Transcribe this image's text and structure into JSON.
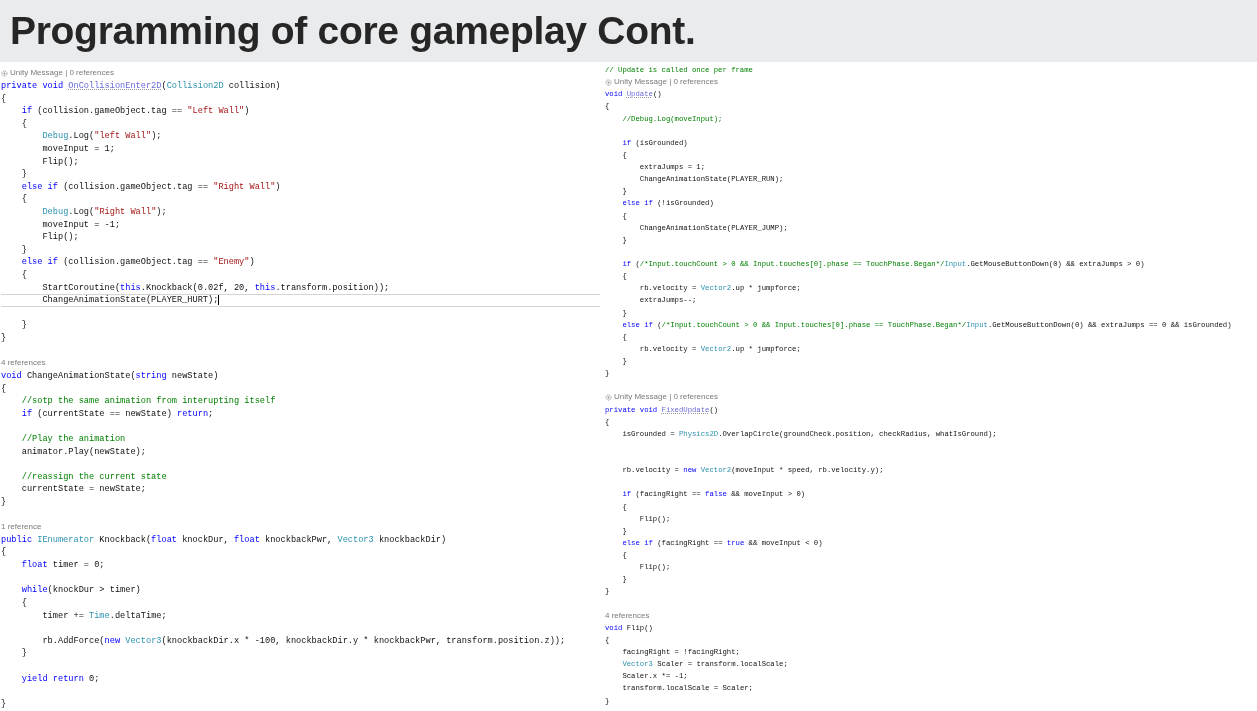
{
  "slide": {
    "title": "Programming of core gameplay Cont."
  },
  "panels": [
    {
      "lines": [
        {
          "kind": "hint_unity",
          "text": "Unity Message | 0 references"
        },
        {
          "kind": "code",
          "parts": [
            {
              "kind": "keyword",
              "text": "private void "
            },
            {
              "kind": "message",
              "text": "OnCollisionEnter2D"
            },
            {
              "text": "("
            },
            {
              "kind": "type",
              "text": "Collision2D"
            },
            {
              "text": " collision)"
            }
          ]
        },
        {
          "kind": "code",
          "parts": [
            {
              "text": "{"
            }
          ]
        },
        {
          "kind": "code",
          "parts": [
            {
              "kind": "keyword",
              "text": "    if"
            },
            {
              "text": " (collision.gameObject.tag == "
            },
            {
              "kind": "string",
              "text": "\"Left Wall\""
            },
            {
              "text": ")"
            }
          ]
        },
        {
          "kind": "code",
          "parts": [
            {
              "text": "    {"
            }
          ]
        },
        {
          "kind": "code",
          "parts": [
            {
              "kind": "type",
              "text": "        Debug"
            },
            {
              "text": ".Log("
            },
            {
              "kind": "string",
              "text": "\"left Wall\""
            },
            {
              "text": ");"
            }
          ]
        },
        {
          "kind": "code",
          "parts": [
            {
              "text": "        moveInput = 1;"
            }
          ]
        },
        {
          "kind": "code",
          "parts": [
            {
              "text": "        Flip();"
            }
          ]
        },
        {
          "kind": "code",
          "parts": [
            {
              "text": "    }"
            }
          ]
        },
        {
          "kind": "code",
          "parts": [
            {
              "kind": "keyword",
              "text": "    else if"
            },
            {
              "text": " (collision.gameObject.tag == "
            },
            {
              "kind": "string",
              "text": "\"Right Wall\""
            },
            {
              "text": ")"
            }
          ]
        },
        {
          "kind": "code",
          "parts": [
            {
              "text": "    {"
            }
          ]
        },
        {
          "kind": "code",
          "parts": [
            {
              "kind": "type",
              "text": "        Debug"
            },
            {
              "text": ".Log("
            },
            {
              "kind": "string",
              "text": "\"Right Wall\""
            },
            {
              "text": ");"
            }
          ]
        },
        {
          "kind": "code",
          "parts": [
            {
              "text": "        moveInput = -1;"
            }
          ]
        },
        {
          "kind": "code",
          "parts": [
            {
              "text": "        Flip();"
            }
          ]
        },
        {
          "kind": "code",
          "parts": [
            {
              "text": "    }"
            }
          ]
        },
        {
          "kind": "code",
          "parts": [
            {
              "kind": "keyword",
              "text": "    else if"
            },
            {
              "text": " (collision.gameObject.tag == "
            },
            {
              "kind": "string",
              "text": "\"Enemy\""
            },
            {
              "text": ")"
            }
          ]
        },
        {
          "kind": "code",
          "parts": [
            {
              "text": "    {"
            }
          ]
        },
        {
          "kind": "code",
          "parts": [
            {
              "text": "        StartCoroutine("
            },
            {
              "kind": "keyword",
              "text": "this"
            },
            {
              "text": ".Knockback(0.02f, 20, "
            },
            {
              "kind": "keyword",
              "text": "this"
            },
            {
              "text": ".transform.position));"
            }
          ]
        },
        {
          "kind": "current",
          "parts": [
            {
              "text": "        ChangeAnimationState(PLAYER_HURT);"
            }
          ]
        },
        {
          "kind": "blank"
        },
        {
          "kind": "code",
          "parts": [
            {
              "text": "    }"
            }
          ]
        },
        {
          "kind": "code",
          "parts": [
            {
              "text": "}"
            }
          ]
        },
        {
          "kind": "blank"
        },
        {
          "kind": "hint",
          "text": "4 references"
        },
        {
          "kind": "code",
          "parts": [
            {
              "kind": "keyword",
              "text": "void"
            },
            {
              "text": " ChangeAnimationState("
            },
            {
              "kind": "keyword",
              "text": "string"
            },
            {
              "text": " newState)"
            }
          ]
        },
        {
          "kind": "code",
          "parts": [
            {
              "text": "{"
            }
          ]
        },
        {
          "kind": "code",
          "parts": [
            {
              "kind": "comment",
              "text": "    //sotp the same animation from interupting itself"
            }
          ]
        },
        {
          "kind": "code",
          "parts": [
            {
              "kind": "keyword",
              "text": "    if"
            },
            {
              "text": " (currentState == newState) "
            },
            {
              "kind": "keyword",
              "text": "return"
            },
            {
              "text": ";"
            }
          ]
        },
        {
          "kind": "blank"
        },
        {
          "kind": "code",
          "parts": [
            {
              "kind": "comment",
              "text": "    //Play the animation"
            }
          ]
        },
        {
          "kind": "code",
          "parts": [
            {
              "text": "    animator.Play(newState);"
            }
          ]
        },
        {
          "kind": "blank"
        },
        {
          "kind": "code",
          "parts": [
            {
              "kind": "comment",
              "text": "    //reassign the current state"
            }
          ]
        },
        {
          "kind": "code",
          "parts": [
            {
              "text": "    currentState = newState;"
            }
          ]
        },
        {
          "kind": "code",
          "parts": [
            {
              "text": "}"
            }
          ]
        },
        {
          "kind": "blank"
        },
        {
          "kind": "hint",
          "text": "1 reference"
        },
        {
          "kind": "code",
          "parts": [
            {
              "kind": "keyword",
              "text": "public "
            },
            {
              "kind": "type",
              "text": "IEnumerator"
            },
            {
              "text": " Knockback("
            },
            {
              "kind": "keyword",
              "text": "float"
            },
            {
              "text": " knockDur, "
            },
            {
              "kind": "keyword",
              "text": "float"
            },
            {
              "text": " knockbackPwr, "
            },
            {
              "kind": "type",
              "text": "Vector3"
            },
            {
              "text": " knockbackDir)"
            }
          ]
        },
        {
          "kind": "code",
          "parts": [
            {
              "text": "{"
            }
          ]
        },
        {
          "kind": "code",
          "parts": [
            {
              "kind": "keyword",
              "text": "    float"
            },
            {
              "text": " timer = 0;"
            }
          ]
        },
        {
          "kind": "blank"
        },
        {
          "kind": "code",
          "parts": [
            {
              "kind": "keyword",
              "text": "    while"
            },
            {
              "text": "(knockDur > timer)"
            }
          ]
        },
        {
          "kind": "code",
          "parts": [
            {
              "text": "    {"
            }
          ]
        },
        {
          "kind": "code",
          "parts": [
            {
              "text": "        timer += "
            },
            {
              "kind": "type",
              "text": "Time"
            },
            {
              "text": ".deltaTime;"
            }
          ]
        },
        {
          "kind": "blank"
        },
        {
          "kind": "code",
          "parts": [
            {
              "text": "        rb.AddForce("
            },
            {
              "kind": "keyword",
              "text": "new "
            },
            {
              "kind": "type",
              "text": "Vector3"
            },
            {
              "text": "(knockbackDir.x * -100, knockbackDir.y * knockbackPwr, transform.position.z));"
            }
          ]
        },
        {
          "kind": "code",
          "parts": [
            {
              "text": "    }"
            }
          ]
        },
        {
          "kind": "blank"
        },
        {
          "kind": "code",
          "parts": [
            {
              "kind": "keyword",
              "text": "    yield return"
            },
            {
              "text": " 0;"
            }
          ]
        },
        {
          "kind": "blank"
        },
        {
          "kind": "code",
          "parts": [
            {
              "text": "}"
            }
          ]
        }
      ]
    },
    {
      "lines": [
        {
          "kind": "code",
          "parts": [
            {
              "kind": "comment",
              "text": "// Update is called once per frame"
            }
          ]
        },
        {
          "kind": "hint_unity",
          "text": "Unity Message | 0 references"
        },
        {
          "kind": "code",
          "parts": [
            {
              "kind": "keyword",
              "text": "void "
            },
            {
              "kind": "message",
              "text": "Update"
            },
            {
              "text": "()"
            }
          ]
        },
        {
          "kind": "code",
          "parts": [
            {
              "text": "{"
            }
          ]
        },
        {
          "kind": "code",
          "parts": [
            {
              "kind": "comment",
              "text": "    //Debug.Log(moveInput);"
            }
          ]
        },
        {
          "kind": "blank"
        },
        {
          "kind": "code",
          "parts": [
            {
              "kind": "keyword",
              "text": "    if"
            },
            {
              "text": " (isGrounded)"
            }
          ]
        },
        {
          "kind": "code",
          "parts": [
            {
              "text": "    {"
            }
          ]
        },
        {
          "kind": "code",
          "parts": [
            {
              "text": "        extraJumps = 1;"
            }
          ]
        },
        {
          "kind": "code",
          "parts": [
            {
              "text": "        ChangeAnimationState(PLAYER_RUN);"
            }
          ]
        },
        {
          "kind": "code",
          "parts": [
            {
              "text": "    }"
            }
          ]
        },
        {
          "kind": "code",
          "parts": [
            {
              "kind": "keyword",
              "text": "    else if"
            },
            {
              "text": " (!isGrounded)"
            }
          ]
        },
        {
          "kind": "code",
          "parts": [
            {
              "text": "    {"
            }
          ]
        },
        {
          "kind": "code",
          "parts": [
            {
              "text": "        ChangeAnimationState(PLAYER_JUMP);"
            }
          ]
        },
        {
          "kind": "code",
          "parts": [
            {
              "text": "    }"
            }
          ]
        },
        {
          "kind": "blank"
        },
        {
          "kind": "code",
          "parts": [
            {
              "kind": "keyword",
              "text": "    if"
            },
            {
              "text": " ("
            },
            {
              "kind": "comment",
              "text": "/*Input.touchCount > 0 && Input.touches[0].phase == TouchPhase.Began*/"
            },
            {
              "kind": "type",
              "text": "Input"
            },
            {
              "text": ".GetMouseButtonDown(0) && extraJumps > 0)"
            }
          ]
        },
        {
          "kind": "code",
          "parts": [
            {
              "text": "    {"
            }
          ]
        },
        {
          "kind": "code",
          "parts": [
            {
              "text": "        rb.velocity = "
            },
            {
              "kind": "type",
              "text": "Vector2"
            },
            {
              "text": ".up * jumpforce;"
            }
          ]
        },
        {
          "kind": "code",
          "parts": [
            {
              "text": "        extraJumps--;"
            }
          ]
        },
        {
          "kind": "code",
          "parts": [
            {
              "text": "    }"
            }
          ]
        },
        {
          "kind": "code",
          "parts": [
            {
              "kind": "keyword",
              "text": "    else if"
            },
            {
              "text": " ("
            },
            {
              "kind": "comment",
              "text": "/*Input.touchCount > 0 && Input.touches[0].phase == TouchPhase.Began*/"
            },
            {
              "kind": "type",
              "text": "Input"
            },
            {
              "text": ".GetMouseButtonDown(0) && extraJumps == 0 && isGrounded)"
            }
          ]
        },
        {
          "kind": "code",
          "parts": [
            {
              "text": "    {"
            }
          ]
        },
        {
          "kind": "code",
          "parts": [
            {
              "text": "        rb.velocity = "
            },
            {
              "kind": "type",
              "text": "Vector2"
            },
            {
              "text": ".up * jumpforce;"
            }
          ]
        },
        {
          "kind": "code",
          "parts": [
            {
              "text": "    }"
            }
          ]
        },
        {
          "kind": "code",
          "parts": [
            {
              "text": "}"
            }
          ]
        },
        {
          "kind": "blank"
        },
        {
          "kind": "hint_unity",
          "text": "Unity Message | 0 references"
        },
        {
          "kind": "code",
          "parts": [
            {
              "kind": "keyword",
              "text": "private void "
            },
            {
              "kind": "message",
              "text": "FixedUpdate"
            },
            {
              "text": "()"
            }
          ]
        },
        {
          "kind": "code",
          "parts": [
            {
              "text": "{"
            }
          ]
        },
        {
          "kind": "code",
          "parts": [
            {
              "text": "    isGrounded = "
            },
            {
              "kind": "type",
              "text": "Physics2D"
            },
            {
              "text": ".OverlapCircle(groundCheck.position, checkRadius, whatIsGround);"
            }
          ]
        },
        {
          "kind": "blank"
        },
        {
          "kind": "blank"
        },
        {
          "kind": "code",
          "parts": [
            {
              "text": "    rb.velocity = "
            },
            {
              "kind": "keyword",
              "text": "new "
            },
            {
              "kind": "type",
              "text": "Vector2"
            },
            {
              "text": "(moveInput * speed, rb.velocity.y);"
            }
          ]
        },
        {
          "kind": "blank"
        },
        {
          "kind": "code",
          "parts": [
            {
              "kind": "keyword",
              "text": "    if"
            },
            {
              "text": " (facingRight == "
            },
            {
              "kind": "keyword",
              "text": "false"
            },
            {
              "text": " && moveInput > 0)"
            }
          ]
        },
        {
          "kind": "code",
          "parts": [
            {
              "text": "    {"
            }
          ]
        },
        {
          "kind": "code",
          "parts": [
            {
              "text": "        Flip();"
            }
          ]
        },
        {
          "kind": "code",
          "parts": [
            {
              "text": "    }"
            }
          ]
        },
        {
          "kind": "code",
          "parts": [
            {
              "kind": "keyword",
              "text": "    else if"
            },
            {
              "text": " (facingRight == "
            },
            {
              "kind": "keyword",
              "text": "true"
            },
            {
              "text": " && moveInput < 0)"
            }
          ]
        },
        {
          "kind": "code",
          "parts": [
            {
              "text": "    {"
            }
          ]
        },
        {
          "kind": "code",
          "parts": [
            {
              "text": "        Flip();"
            }
          ]
        },
        {
          "kind": "code",
          "parts": [
            {
              "text": "    }"
            }
          ]
        },
        {
          "kind": "code",
          "parts": [
            {
              "text": "}"
            }
          ]
        },
        {
          "kind": "blank"
        },
        {
          "kind": "hint",
          "text": "4 references"
        },
        {
          "kind": "code",
          "parts": [
            {
              "kind": "keyword",
              "text": "void"
            },
            {
              "text": " Flip()"
            }
          ]
        },
        {
          "kind": "code",
          "parts": [
            {
              "text": "{"
            }
          ]
        },
        {
          "kind": "code",
          "parts": [
            {
              "text": "    facingRight = !facingRight;"
            }
          ]
        },
        {
          "kind": "code",
          "parts": [
            {
              "kind": "type",
              "text": "    Vector3"
            },
            {
              "text": " Scaler = transform.localScale;"
            }
          ]
        },
        {
          "kind": "code",
          "parts": [
            {
              "text": "    Scaler.x *= -1;"
            }
          ]
        },
        {
          "kind": "code",
          "parts": [
            {
              "text": "    transform.localScale = Scaler;"
            }
          ]
        },
        {
          "kind": "code",
          "parts": [
            {
              "text": "}"
            }
          ]
        }
      ]
    }
  ]
}
